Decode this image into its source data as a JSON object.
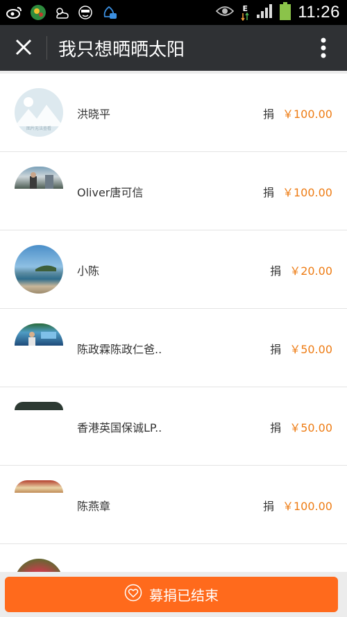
{
  "status_bar": {
    "time": "11:26",
    "network_type": "E",
    "left_icons": [
      "weibo-icon",
      "app-icon",
      "weather-icon",
      "smiley-icon",
      "qq-icon"
    ],
    "right_icons": [
      "eye-icon",
      "network-icon",
      "signal-icon",
      "battery-icon"
    ]
  },
  "nav": {
    "title": "我只想晒晒太阳"
  },
  "donors": [
    {
      "name": "洪晓平",
      "label": "捐",
      "amount": "￥100.00",
      "avatar": "placeholder"
    },
    {
      "name": "Oliver唐可信",
      "label": "捐",
      "amount": "￥100.00",
      "avatar": "photo"
    },
    {
      "name": "小陈",
      "label": "捐",
      "amount": "￥20.00",
      "avatar": "beach"
    },
    {
      "name": "陈政霖陈政仁爸..",
      "label": "捐",
      "amount": "￥50.00",
      "avatar": "photo"
    },
    {
      "name": "香港英国保诚LP..",
      "label": "捐",
      "amount": "￥50.00",
      "avatar": "photo"
    },
    {
      "name": "陈燕章",
      "label": "捐",
      "amount": "￥100.00",
      "avatar": "photo"
    },
    {
      "name": "",
      "label": "",
      "amount": "",
      "avatar": "flower"
    }
  ],
  "placeholder_avatar_text": "图片无法查看",
  "bottom_button": {
    "label": "募捐已结束"
  },
  "colors": {
    "accent": "#ff6a1c",
    "amount": "#ee7c14",
    "navbar": "#2f3134"
  }
}
